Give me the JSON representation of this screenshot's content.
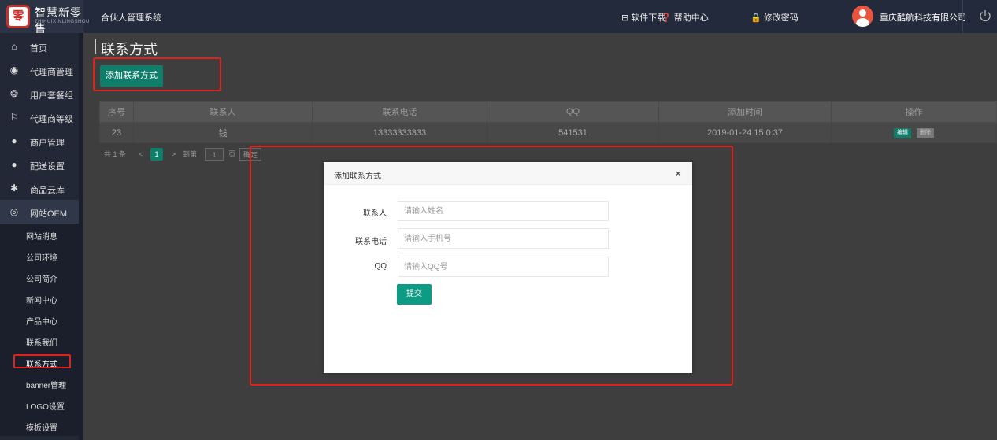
{
  "header": {
    "logo_text": "零",
    "logo_title": "智慧新零售",
    "logo_subtitle": "ZHIHUIXINLINGSHOU",
    "system_name": "合伙人管理系统",
    "download_label": "软件下载",
    "help_label": "帮助中心",
    "change_password_label": "修改密码",
    "company_name": "重庆酷航科技有限公司"
  },
  "sidebar": {
    "items": [
      {
        "label": "首页",
        "icon": "home-icon"
      },
      {
        "label": "代理商管理",
        "icon": "agent-icon"
      },
      {
        "label": "用户套餐组",
        "icon": "package-icon"
      },
      {
        "label": "代理商等级",
        "icon": "level-icon"
      },
      {
        "label": "商户管理",
        "icon": "merchant-icon"
      },
      {
        "label": "配送设置",
        "icon": "delivery-icon"
      },
      {
        "label": "商品云库",
        "icon": "cloud-store-icon"
      },
      {
        "label": "网站OEM",
        "icon": "oem-icon"
      }
    ],
    "sub_items": [
      {
        "label": "网站消息"
      },
      {
        "label": "公司环境"
      },
      {
        "label": "公司简介"
      },
      {
        "label": "新闻中心"
      },
      {
        "label": "产品中心"
      },
      {
        "label": "联系我们"
      },
      {
        "label": "联系方式"
      },
      {
        "label": "banner管理"
      },
      {
        "label": "LOGO设置"
      },
      {
        "label": "模板设置"
      }
    ]
  },
  "page": {
    "title": "联系方式",
    "add_button": "添加联系方式"
  },
  "table": {
    "columns": [
      "序号",
      "联系人",
      "联系电话",
      "QQ",
      "添加时间",
      "操作"
    ],
    "rows": [
      {
        "id": "23",
        "contact": "钱",
        "phone": "13333333333",
        "qq": "541531",
        "time": "2019-01-24 15:0:37",
        "edit": "编辑",
        "delete": "删除"
      }
    ]
  },
  "pager": {
    "total": "共 1 条",
    "prev": "<",
    "current": "1",
    "next": ">",
    "goto": "到第",
    "page_input": "1",
    "page_unit": "页",
    "confirm": "确定"
  },
  "dialog": {
    "title": "添加联系方式",
    "close": "×",
    "fields": [
      {
        "label": "联系人",
        "placeholder": "请输入姓名"
      },
      {
        "label": "联系电话",
        "placeholder": "请输入手机号"
      },
      {
        "label": "QQ",
        "placeholder": "请输入QQ号"
      }
    ],
    "submit": "提交"
  },
  "colors": {
    "header_bg": "#232a3b",
    "accent": "#0e7d6a",
    "highlight_border": "#e0221b"
  }
}
